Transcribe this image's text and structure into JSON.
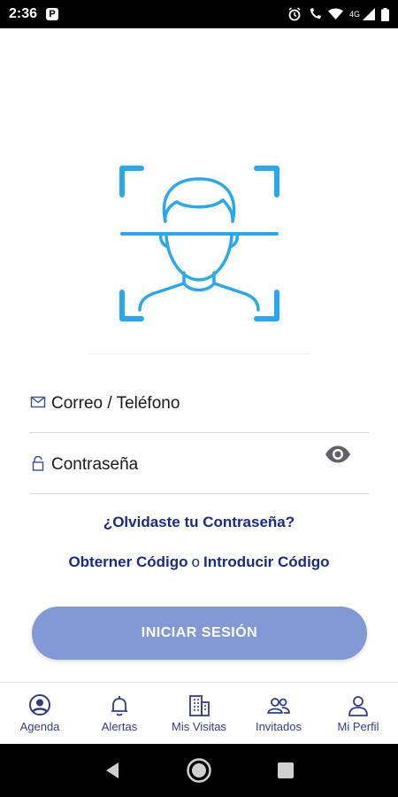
{
  "status_bar": {
    "time": "2:36",
    "network": "4G"
  },
  "login": {
    "email_placeholder": "Correo / Teléfono",
    "password_placeholder": "Contraseña",
    "forgot_password": "¿Olvidaste tu Contraseña?",
    "get_code": "Obterner Código",
    "or": "o",
    "enter_code": "Introducir Código",
    "submit_label": "INICIAR SESIÓN"
  },
  "nav": {
    "items": [
      {
        "label": "Agenda",
        "icon": "user-circle-icon"
      },
      {
        "label": "Alertas",
        "icon": "bell-icon"
      },
      {
        "label": "Mis Visitas",
        "icon": "building-icon"
      },
      {
        "label": "Invitados",
        "icon": "users-icon"
      },
      {
        "label": "Mi Perfil",
        "icon": "user-icon"
      }
    ]
  },
  "colors": {
    "accent": "#29a8f0",
    "primary_text": "#1a2a8c",
    "button": "#8299d6",
    "nav_icon": "#333c8c"
  }
}
